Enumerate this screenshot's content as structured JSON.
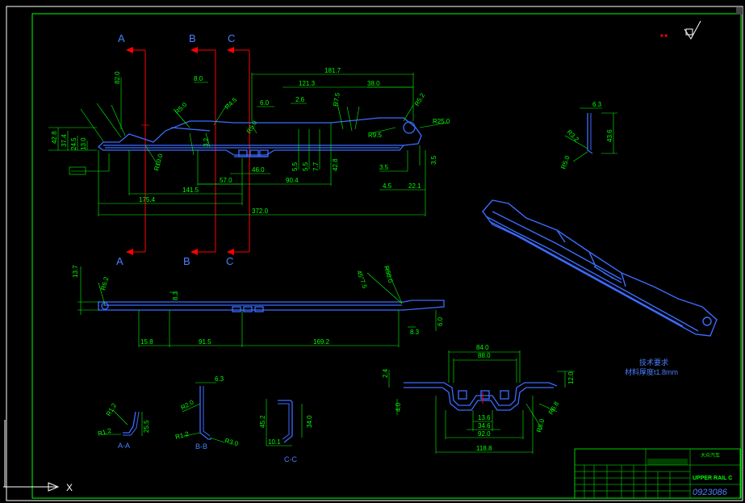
{
  "sections": {
    "top": [
      "A",
      "B",
      "C"
    ],
    "bottom": [
      "A",
      "B",
      "C"
    ]
  },
  "section_views": [
    "A-A",
    "B-B",
    "C-C"
  ],
  "top_view_dims": {
    "overall": "372.0",
    "d1": "175.4",
    "d2": "141.5",
    "d3": "57.0",
    "d4": "90.4",
    "d5": "46.0",
    "d6": "181.7",
    "d7": "121.3",
    "d8": "38.0",
    "d9": "22.1",
    "d10": "4.5",
    "d11": "3.5",
    "d12": "42.8",
    "d13": "8.0",
    "d14": "6.0",
    "d15": "2.6",
    "d16": "82.0",
    "d17": "42.8",
    "d18": "37.4",
    "d19": "24.5",
    "d20": "13.0",
    "d21": "3.5",
    "r1": "R25.0",
    "r2": "R5.2",
    "r3": "R9.5",
    "r4": "R7.5",
    "r5": "R5.0",
    "r6": "R4.5",
    "r7": "R10.0",
    "r8": "R5.0",
    "v1": "5.5",
    "v2": "5.5",
    "v3": "7.7",
    "v4": "3.2"
  },
  "side_view_dims": {
    "d1": "15.8",
    "d2": "91.5",
    "d3": "169.2",
    "d4": "13.7",
    "d5": "8.3",
    "d6": "6.0",
    "d7": "8.3",
    "r1": "R6.2",
    "r2": "R50.0",
    "a1": "45°7.5"
  },
  "front_view_dims": {
    "d1": "84.0",
    "d2": "88.0",
    "d3": "92.0",
    "d4": "118.8",
    "d5": "34.6",
    "d6": "13.6",
    "d7": "12.0",
    "d8": "2.4",
    "d9": "4.0",
    "r1": "R6.8",
    "r2": "R5.0"
  },
  "right_detail_dims": {
    "d1": "6.3",
    "d2": "43.6",
    "r1": "R3.2",
    "r2": "R5.0"
  },
  "aa_dims": {
    "r1": "R1.2",
    "r2": "R1.2",
    "d1": "25.5"
  },
  "bb_dims": {
    "d1": "6.3",
    "r1": "R2.0",
    "r2": "R1.2",
    "r3": "R3.0"
  },
  "cc_dims": {
    "d1": "45.2",
    "d2": "34.0",
    "d3": "10.1"
  },
  "note": {
    "line1": "技术要求",
    "line2": "材料厚度t1.8mm"
  },
  "title_block": {
    "part_name_cn": "UPPER RAIL C",
    "part_no": "0923086",
    "company": "大众汽车"
  },
  "colors": {
    "background": "#000000",
    "dimension": "#00ff00",
    "part": "#3b6cff",
    "section_line": "#ff0000",
    "frame": "#00ff00"
  }
}
